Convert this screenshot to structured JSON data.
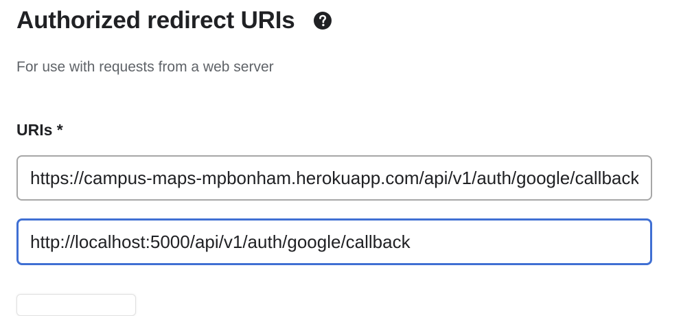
{
  "section": {
    "title": "Authorized redirect URIs",
    "help_icon": "help-circle-icon",
    "subtitle": "For use with requests from a web server"
  },
  "uris": {
    "label": "URIs *",
    "entries": [
      "https://campus-maps-mpbonham.herokuapp.com/api/v1/auth/google/callback",
      "http://localhost:5000/api/v1/auth/google/callback"
    ],
    "focused_index": 1
  },
  "colors": {
    "text": "#202124",
    "subtitle": "#5f6368",
    "input_border": "#a6a6a6",
    "focus_border": "#3f6fd3"
  }
}
